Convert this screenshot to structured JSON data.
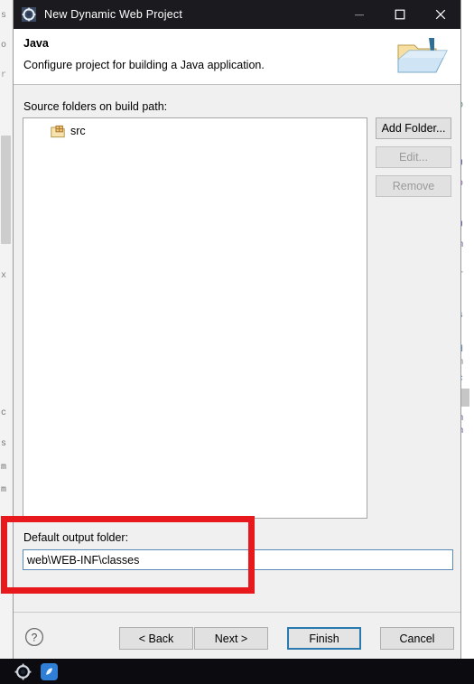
{
  "window": {
    "title": "New Dynamic Web Project",
    "icon": "eclipse-gear-icon",
    "controls": {
      "minimize": "minimize-icon",
      "maximize": "maximize-icon",
      "close": "close-icon"
    }
  },
  "header": {
    "title": "Java",
    "subtitle": "Configure project for building a Java application.",
    "banner_icon": "java-project-folder-icon"
  },
  "main": {
    "source_folders_label": "Source folders on build path:",
    "tree": [
      {
        "label": "src",
        "icon": "source-folder-icon"
      }
    ],
    "side_buttons": [
      {
        "label": "Add Folder...",
        "enabled": true
      },
      {
        "label": "Edit...",
        "enabled": false
      },
      {
        "label": "Remove",
        "enabled": false
      }
    ],
    "output_folder_label": "Default output folder:",
    "output_folder_value": "web\\WEB-INF\\classes",
    "output_folder_placeholder": "Default output folder"
  },
  "footer": {
    "help_icon": "help-icon",
    "buttons": [
      {
        "label": "< Back",
        "default": false
      },
      {
        "label": "Next >",
        "default": false
      },
      {
        "label": "Finish",
        "default": true
      },
      {
        "label": "Cancel",
        "default": false
      }
    ]
  },
  "annotation": {
    "shape": "rectangle-highlight",
    "color": "#e8191d"
  },
  "taskbar": {
    "icons": [
      "eclipse-gear-icon",
      "app-blue-icon"
    ]
  },
  "background": {
    "left_fragments": [
      "s",
      "o",
      "r",
      "x",
      "c",
      "s",
      "m",
      "m"
    ],
    "right_fragments": [
      "D",
      "J",
      "p",
      "J",
      "m",
      "T",
      "s",
      "d",
      "m",
      "c",
      "D",
      "m",
      "m"
    ]
  }
}
